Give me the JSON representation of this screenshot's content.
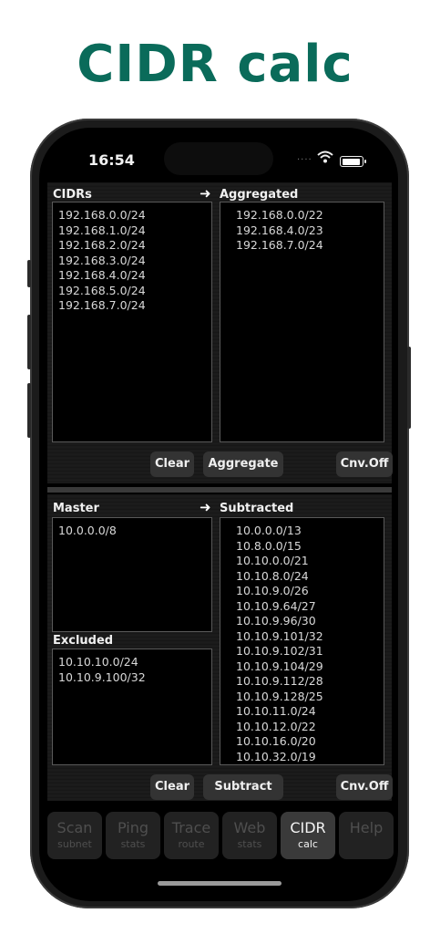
{
  "header": {
    "title": "CIDR calc"
  },
  "status": {
    "time": "16:54",
    "signal_dots": "····"
  },
  "top": {
    "left_label": "CIDRs",
    "right_label": "Aggregated",
    "arrow": "➜",
    "cidrs": [
      "192.168.0.0/24",
      "192.168.1.0/24",
      "192.168.2.0/24",
      "192.168.3.0/24",
      "192.168.4.0/24",
      "192.168.5.0/24",
      "192.168.7.0/24"
    ],
    "aggregated": [
      "192.168.0.0/22",
      "192.168.4.0/23",
      "192.168.7.0/24"
    ],
    "buttons": {
      "clear": "Clear",
      "aggregate": "Aggregate",
      "cnv": "Cnv.Off"
    }
  },
  "bottom": {
    "master_label": "Master",
    "subtracted_label": "Subtracted",
    "excluded_label": "Excluded",
    "arrow": "➜",
    "master": [
      "10.0.0.0/8"
    ],
    "excluded": [
      "10.10.10.0/24",
      "10.10.9.100/32"
    ],
    "subtracted": [
      "10.0.0.0/13",
      "10.8.0.0/15",
      "10.10.0.0/21",
      "10.10.8.0/24",
      "10.10.9.0/26",
      "10.10.9.64/27",
      "10.10.9.96/30",
      "10.10.9.101/32",
      "10.10.9.102/31",
      "10.10.9.104/29",
      "10.10.9.112/28",
      "10.10.9.128/25",
      "10.10.11.0/24",
      "10.10.12.0/22",
      "10.10.16.0/20",
      "10.10.32.0/19"
    ],
    "buttons": {
      "clear": "Clear",
      "subtract": "Subtract",
      "cnv": "Cnv.Off"
    }
  },
  "tabs": [
    {
      "line1": "Scan",
      "line2": "subnet",
      "active": false
    },
    {
      "line1": "Ping",
      "line2": "stats",
      "active": false
    },
    {
      "line1": "Trace",
      "line2": "route",
      "active": false
    },
    {
      "line1": "Web",
      "line2": "stats",
      "active": false
    },
    {
      "line1": "CIDR",
      "line2": "calc",
      "active": true
    },
    {
      "line1": "Help",
      "line2": "",
      "active": false
    }
  ]
}
